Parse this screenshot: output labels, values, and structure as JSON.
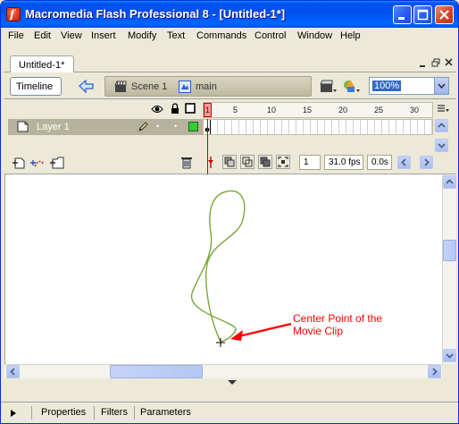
{
  "window": {
    "title": "Macromedia Flash Professional 8 - [Untitled-1*]",
    "app_icon_letter": "f"
  },
  "menubar": {
    "items": [
      "File",
      "Edit",
      "View",
      "Insert",
      "Modify",
      "Text",
      "Commands",
      "Control",
      "Window",
      "Help"
    ]
  },
  "document": {
    "tab_label": "Untitled-1*"
  },
  "editbar": {
    "timeline_button": "Timeline",
    "breadcrumbs": [
      "Scene 1",
      "main"
    ],
    "zoom_value": "100%"
  },
  "timeline": {
    "ruler_labels": [
      "1",
      "5",
      "10",
      "15",
      "20",
      "25",
      "30"
    ],
    "layer_name": "Layer 1",
    "current_frame": "1",
    "frame_rate": "31.0 fps",
    "elapsed_time": "0.0s"
  },
  "stage": {
    "annotation_line1": "Center Point of the",
    "annotation_line2": "Movie Clip",
    "annotation_color": "#ff0000",
    "stroke_color": "#7aa73a"
  },
  "panels": {
    "tabs": [
      "Properties",
      "Filters",
      "Parameters"
    ]
  }
}
